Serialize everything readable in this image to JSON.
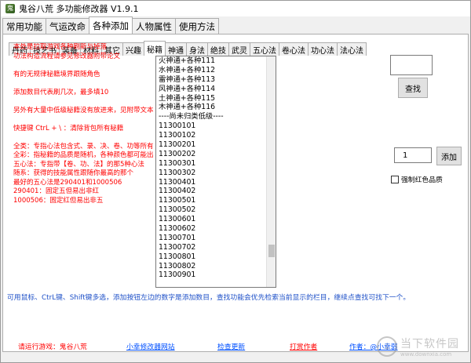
{
  "window": {
    "title": "鬼谷八荒 多功能修改器  V1.9.1"
  },
  "top_tabs": [
    "常用功能",
    "气运改命",
    "各种添加",
    "人物属性",
    "使用方法"
  ],
  "top_tab_active": 2,
  "sub_tabs": [
    "丹药",
    "技艺书",
    "装备",
    "材料",
    "其它",
    "兴趣",
    "秘籍",
    "神通",
    "身法",
    "绝技",
    "武灵",
    "五心法",
    "卷心法",
    "功心法",
    "法心法"
  ],
  "sub_tab_active": 6,
  "notes": [
    "本处是拉取游戏各种刷新与掉落",
    "功法构造流程请参见修改器附带论文",
    "",
    "有的无规律秘籍境界跟随角色",
    "",
    "添加数目代表刷几次，最多填10",
    "",
    "另外有大量中低级秘籍没有放进来，见附带文本",
    "",
    "快捷键 CtrL + \\ ：清除背包所有秘籍",
    "",
    "全类：专指心法包含式、录、决、卷、功等所有",
    "全彩：指秘籍的品质是随机，各种颜色都可能出",
    "五心法：专指带【卷、功、法】的那5种心法",
    "随系：获得的技能属性跟随你最高的那个",
    "最好的五心法是290401和1000506",
    "290401：固定五但易出非红",
    "1000506：固定红但易出非五"
  ],
  "list_items": [
    "火神通+各种111",
    "水神通+各种112",
    "雷神通+各种113",
    "风神通+各种114",
    "土神通+各种115",
    "木神通+各种116",
    "----尚未归类低级----",
    "11300101",
    "11300102",
    "11300201",
    "11300202",
    "11300301",
    "11300302",
    "11300401",
    "11300402",
    "11300501",
    "11300502",
    "11300601",
    "11300602",
    "11300701",
    "11300702",
    "11300801",
    "11300802",
    "11300901"
  ],
  "search": {
    "value": "",
    "button": "查找"
  },
  "add": {
    "quantity": "1",
    "button": "添加"
  },
  "force_red": {
    "label": "强制红色品质",
    "checked": false
  },
  "hint": "可用鼠标、CtrL键、Shift键多选，添加按钮左边的数字是添加数目，查找功能会优先检索当前显示的栏目，继续点查找可找下一个。",
  "footer": {
    "game": "请运行游戏：鬼谷八荒",
    "site": "小幸修改器网站",
    "update": "检查更新",
    "donate": "打赏作者",
    "author": "作者：@小幸弱"
  },
  "watermark": {
    "cn": "当下软件园",
    "en": "www.downxia.com"
  },
  "colors": {
    "note_red": "#ff0000",
    "link_blue": "#0050ff",
    "hint_blue": "#1e50c8"
  }
}
